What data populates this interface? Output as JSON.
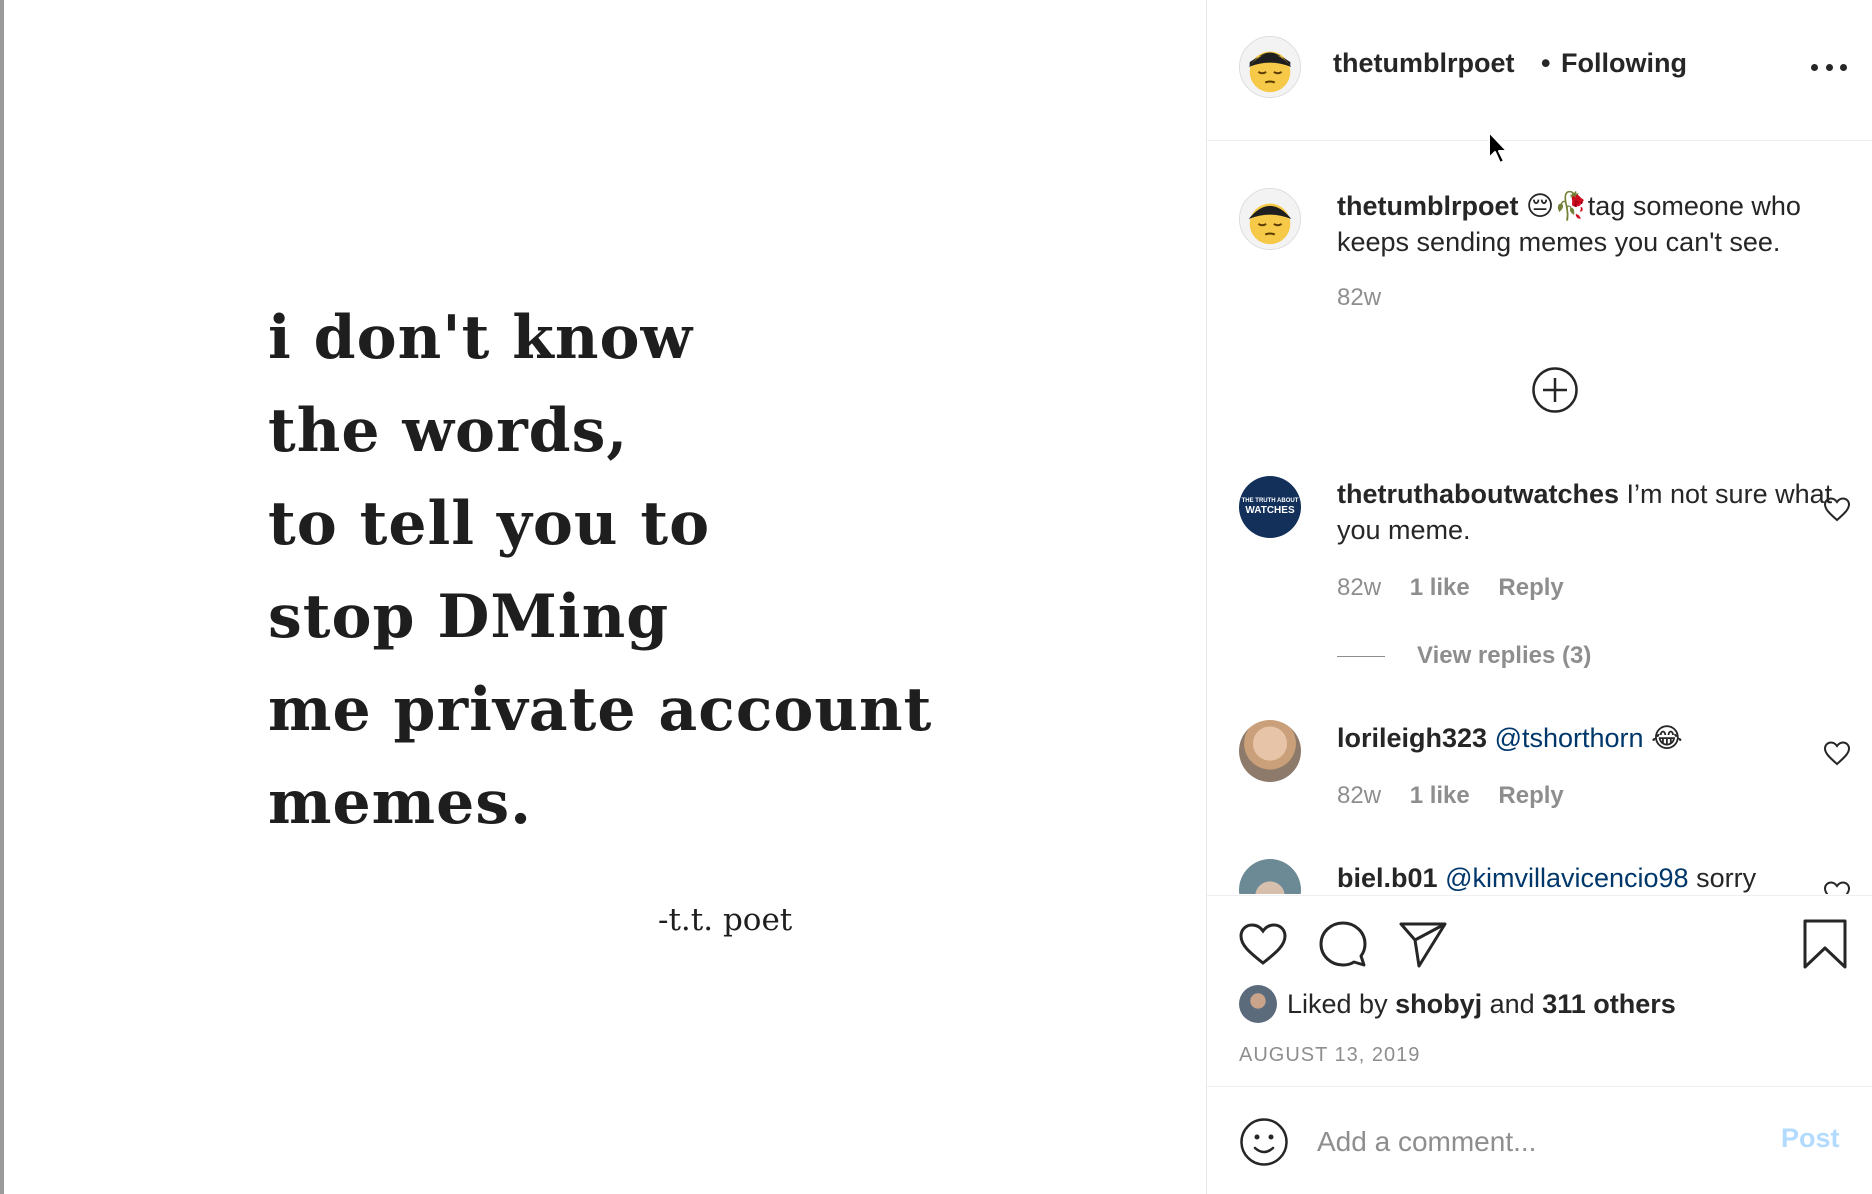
{
  "post": {
    "image_text": {
      "lines": [
        "i don't know",
        "the words,",
        "to tell you to",
        "stop DMing",
        "me private account",
        "memes."
      ],
      "signature": "-t.t. poet"
    }
  },
  "header": {
    "username": "thetumblrpoet",
    "separator": "•",
    "follow_status": "Following",
    "avatar_icon": "sleepy-face-avatar",
    "more_icon": "more-options-icon"
  },
  "caption": {
    "username": "thetumblrpoet",
    "emojis": "😔🥀",
    "text": "tag someone who keeps sending memes you can't see.",
    "time": "82w"
  },
  "comments": [
    {
      "username": "thetruthaboutwatches",
      "text": "I’m not sure what you meme.",
      "time": "82w",
      "likes": "1 like",
      "reply": "Reply",
      "view_replies": "View replies (3)",
      "avatar_text_small": "THE TRUTH ABOUT",
      "avatar_text_big": "WATCHES"
    },
    {
      "username": "lorileigh323",
      "mention": "@tshorthorn",
      "emoji": "😂",
      "time": "82w",
      "likes": "1 like",
      "reply": "Reply"
    },
    {
      "username": "biel.b01",
      "mention": "@kimvillavicencio98",
      "text": "sorry"
    }
  ],
  "actions": {
    "liked_prefix": "Liked by",
    "liked_user": "shobyj",
    "liked_and": "and",
    "liked_others": "311 others",
    "date": "AUGUST 13, 2019"
  },
  "comment_box": {
    "placeholder": "Add a comment...",
    "post_label": "Post"
  },
  "colors": {
    "text": "#262626",
    "secondary": "#8e8e8e",
    "mention": "#00376b",
    "post_disabled": "#b3dbff",
    "divider": "#efefef"
  }
}
